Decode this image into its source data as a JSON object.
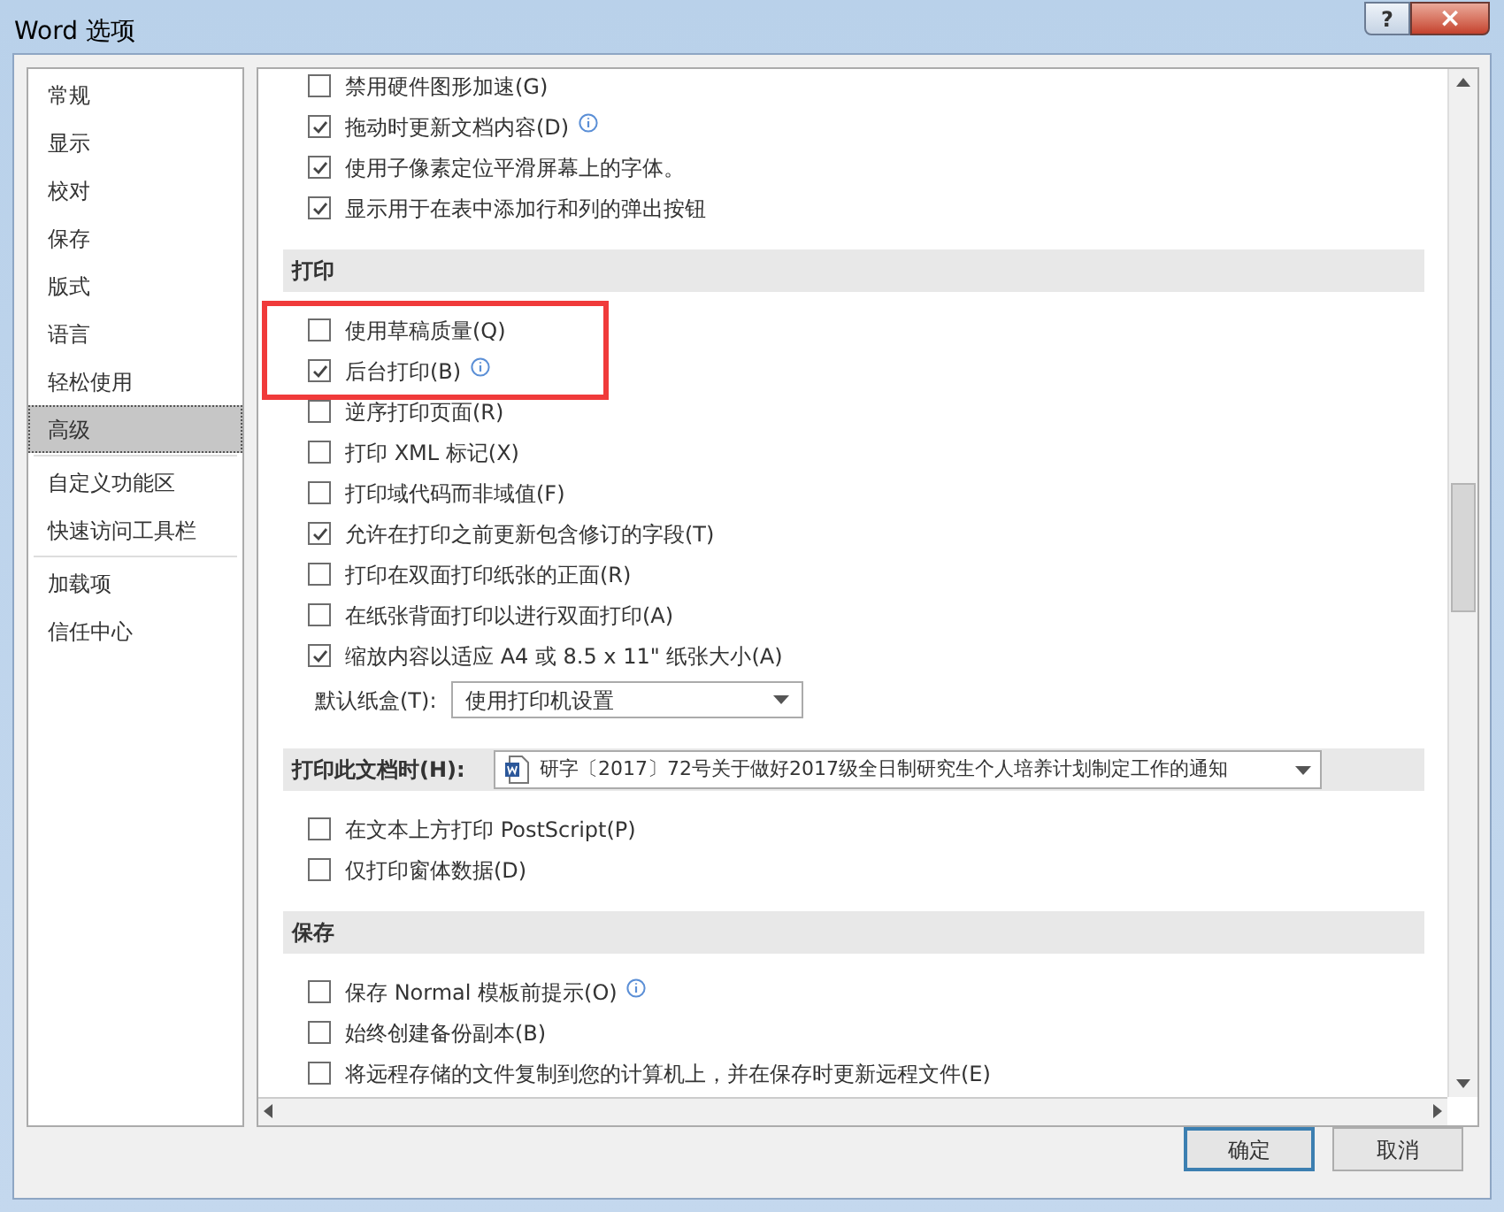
{
  "window": {
    "title": "Word 选项",
    "help": "?",
    "close": "×"
  },
  "sidebar": {
    "groups": [
      [
        {
          "label": "常规",
          "selected": false
        },
        {
          "label": "显示",
          "selected": false
        },
        {
          "label": "校对",
          "selected": false
        },
        {
          "label": "保存",
          "selected": false
        },
        {
          "label": "版式",
          "selected": false
        },
        {
          "label": "语言",
          "selected": false
        },
        {
          "label": "轻松使用",
          "selected": false
        },
        {
          "label": "高级",
          "selected": true
        }
      ],
      [
        {
          "label": "自定义功能区",
          "selected": false
        },
        {
          "label": "快速访问工具栏",
          "selected": false
        }
      ],
      [
        {
          "label": "加载项",
          "selected": false
        },
        {
          "label": "信任中心",
          "selected": false
        }
      ]
    ]
  },
  "content": [
    {
      "kind": "checkbox",
      "label": "禁用硬件图形加速(G)",
      "checked": false,
      "info": false
    },
    {
      "kind": "checkbox",
      "label": "拖动时更新文档内容(D)",
      "checked": true,
      "info": true
    },
    {
      "kind": "checkbox",
      "label": "使用子像素定位平滑屏幕上的字体。",
      "checked": true,
      "info": false
    },
    {
      "kind": "checkbox",
      "label": "显示用于在表中添加行和列的弹出按钮",
      "checked": true,
      "info": false
    },
    {
      "kind": "header",
      "label": "打印"
    },
    {
      "kind": "highlight",
      "items": [
        {
          "kind": "checkbox",
          "label": "使用草稿质量(Q)",
          "checked": false,
          "info": false
        },
        {
          "kind": "checkbox",
          "label": "后台打印(B)",
          "checked": true,
          "info": true
        }
      ]
    },
    {
      "kind": "checkbox",
      "label": "逆序打印页面(R)",
      "checked": false,
      "info": false
    },
    {
      "kind": "checkbox",
      "label": "打印 XML 标记(X)",
      "checked": false,
      "info": false
    },
    {
      "kind": "checkbox",
      "label": "打印域代码而非域值(F)",
      "checked": false,
      "info": false
    },
    {
      "kind": "checkbox",
      "label": "允许在打印之前更新包含修订的字段(T)",
      "checked": true,
      "info": false
    },
    {
      "kind": "checkbox",
      "label": "打印在双面打印纸张的正面(R)",
      "checked": false,
      "info": false
    },
    {
      "kind": "checkbox",
      "label": "在纸张背面打印以进行双面打印(A)",
      "checked": false,
      "info": false
    },
    {
      "kind": "checkbox",
      "label": "缩放内容以适应 A4 或 8.5 x 11\" 纸张大小(A)",
      "checked": true,
      "info": false
    },
    {
      "kind": "dropdown",
      "label": "默认纸盒(T):",
      "value": "使用打印机设置"
    },
    {
      "kind": "doc_header",
      "label": "打印此文档时(H):",
      "value": "研字〔2017〕72号关于做好2017级全日制研究生个人培养计划制定工作的通知"
    },
    {
      "kind": "checkbox",
      "label": "在文本上方打印 PostScript(P)",
      "checked": false,
      "info": false
    },
    {
      "kind": "checkbox",
      "label": "仅打印窗体数据(D)",
      "checked": false,
      "info": false
    },
    {
      "kind": "header",
      "label": "保存"
    },
    {
      "kind": "checkbox",
      "label": "保存 Normal 模板前提示(O)",
      "checked": false,
      "info": true
    },
    {
      "kind": "checkbox",
      "label": "始终创建备份副本(B)",
      "checked": false,
      "info": false
    },
    {
      "kind": "checkbox",
      "label": "将远程存储的文件复制到您的计算机上，并在保存时更新远程文件(E)",
      "checked": false,
      "info": false
    }
  ],
  "buttons": [
    {
      "label": "确定",
      "default": true
    },
    {
      "label": "取消",
      "default": false
    }
  ]
}
